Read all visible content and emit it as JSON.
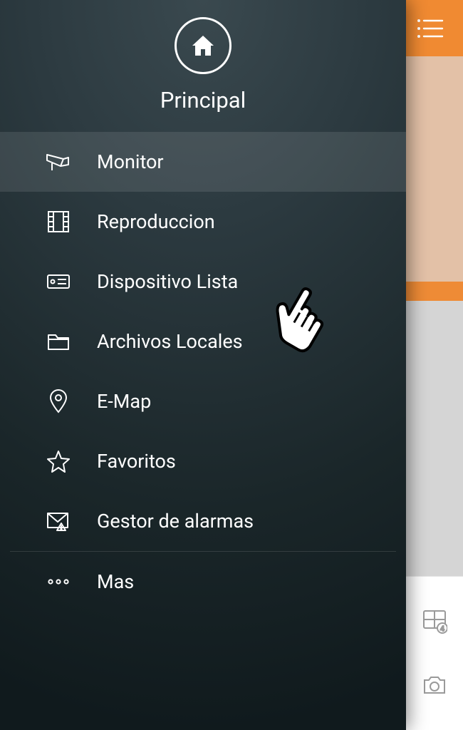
{
  "sidebar": {
    "title": "Principal",
    "items": [
      {
        "label": "Monitor",
        "icon": "camera-icon",
        "active": true
      },
      {
        "label": "Reproduccion",
        "icon": "film-icon",
        "active": false
      },
      {
        "label": "Dispositivo Lista",
        "icon": "device-icon",
        "active": false
      },
      {
        "label": "Archivos Locales",
        "icon": "folder-icon",
        "active": false
      },
      {
        "label": "E-Map",
        "icon": "pin-icon",
        "active": false
      },
      {
        "label": "Favoritos",
        "icon": "star-icon",
        "active": false
      },
      {
        "label": "Gestor de alarmas",
        "icon": "alarm-icon",
        "active": false
      }
    ],
    "more_label": "Mas"
  },
  "cursor_target": "Dispositivo Lista"
}
